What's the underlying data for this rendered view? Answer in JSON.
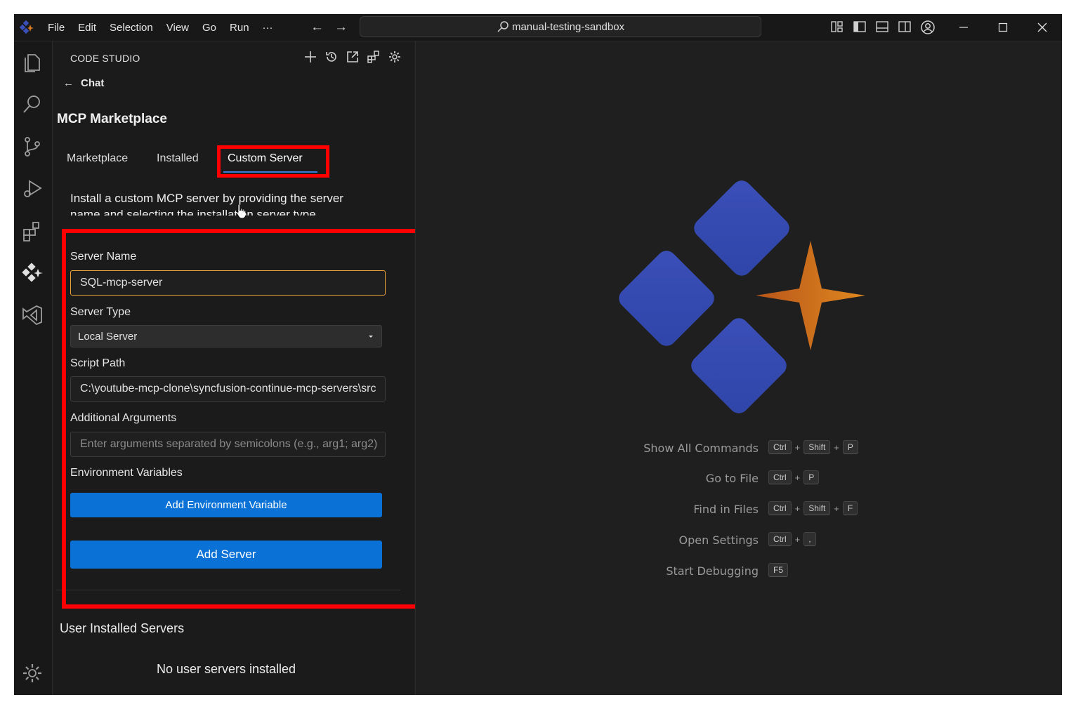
{
  "titlebar": {
    "menu": [
      "File",
      "Edit",
      "Selection",
      "View",
      "Go",
      "Run",
      "···"
    ],
    "search": "manual-testing-sandbox",
    "back_arrow": "←",
    "forward_arrow": "→"
  },
  "sidebar": {
    "header": "CODE STUDIO",
    "back_arrow": "←",
    "back_label": "Chat",
    "title": "MCP Marketplace",
    "tabs": [
      "Marketplace",
      "Installed",
      "Custom Server"
    ],
    "active_tab": "Custom Server",
    "description": "Install a custom MCP server by providing the server name and selecting the installation server type.",
    "form": {
      "server_name_label": "Server Name",
      "server_name_value": "SQL-mcp-server",
      "server_type_label": "Server Type",
      "server_type_value": "Local Server",
      "script_path_label": "Script Path",
      "script_path_value": "C:\\youtube-mcp-clone\\syncfusion-continue-mcp-servers\\src",
      "additional_args_label": "Additional Arguments",
      "additional_args_placeholder": "Enter arguments separated by semicolons (e.g., arg1; arg2)",
      "env_vars_label": "Environment Variables",
      "add_env_button": "Add Environment Variable",
      "add_server_button": "Add Server"
    },
    "user_installed_title": "User Installed Servers",
    "no_servers_text": "No user servers installed"
  },
  "editor": {
    "shortcuts": [
      {
        "label": "Show All Commands",
        "keys": [
          "Ctrl",
          "Shift",
          "P"
        ]
      },
      {
        "label": "Go to File",
        "keys": [
          "Ctrl",
          "P"
        ]
      },
      {
        "label": "Find in Files",
        "keys": [
          "Ctrl",
          "Shift",
          "F"
        ]
      },
      {
        "label": "Open Settings",
        "keys": [
          "Ctrl",
          ","
        ]
      },
      {
        "label": "Start Debugging",
        "keys": [
          "F5"
        ]
      }
    ]
  },
  "colors": {
    "accent_blue": "#0a72d6",
    "highlight_red": "#ff0000",
    "focus_orange": "#e8a23a",
    "logo_blue": "#3b4fb8",
    "logo_orange": "#d97a1e"
  },
  "icons": {
    "activity_bar": [
      "explorer-icon",
      "search-icon",
      "source-control-icon",
      "run-debug-icon",
      "extensions-icon",
      "code-studio-icon",
      "visual-studio-icon",
      "settings-gear-icon"
    ]
  }
}
